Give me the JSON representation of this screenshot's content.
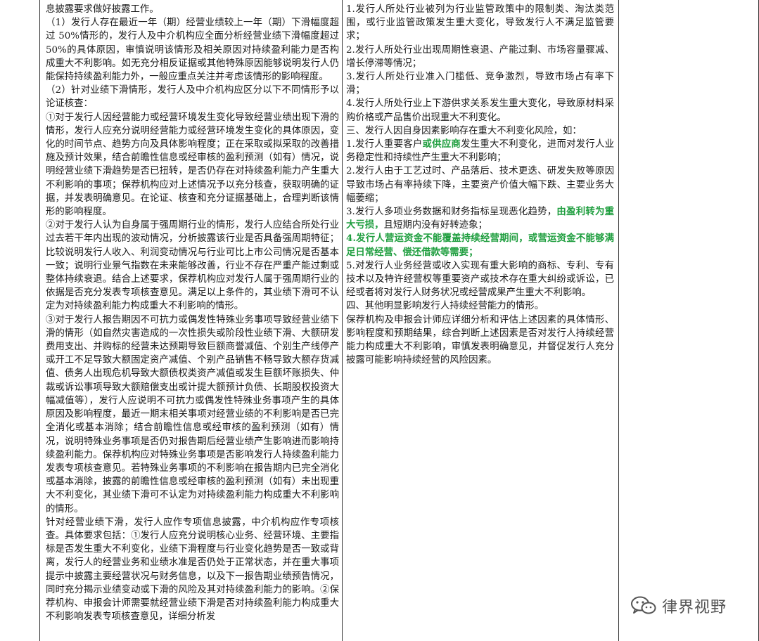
{
  "left_paragraphs": [
    "息披露要求做好披露工作。",
    "（1）发行人存在最近一年（期）经营业绩较上一年（期）下滑幅度超过 50%情形的，发行人及中介机构应全面分析经营业绩下滑幅度超过 50%的具体原因，审慎说明该情形及相关原因对持续盈利能力是否构成重大不利影响。如无充分相反证据或其他特殊原因能够说明发行人仍能保持持续盈利能力外，一般应重点关注并考虑该情形的影响程度。",
    "（2）针对业绩下滑情形，发行人及中介机构应区分以下不同情形予以论证核查：",
    "①对于发行人因经营能力或经营环境发生变化导致经营业绩出现下滑的情形，发行人应充分说明经营能力或经营环境发生变化的具体原因，变化的时间节点、趋势方向及具体影响程度；正在采取或拟采取的改善措施及预计效果，结合前瞻性信息或经审核的盈利预测（如有）情况，说明经营业绩下滑趋势是否已扭转，是否仍存在对持续盈利能力产生重大不利影响的事项；保荐机构应对上述情况予以充分核查，获取明确的证据，并发表明确意见。在论证、核查和充分证据基础上，合理判断该情形的影响程度。",
    "②对于发行人认为自身属于强周期行业的情形，发行人应结合所处行业过去若干年内出现的波动情况，分析披露该行业是否具备强周期特征；比较说明发行人收入、利润变动情况与行业可比上市公司情况是否基本一致；说明行业景气指数在未来能够改善，行业不存在严重产能过剩或整体持续衰退。结合上述要求，保荐机构应对发行人属于强周期行业的依据是否充分发表专项核查意见。满足以上条件的，其业绩下滑可不认定为对持续盈利能力构成重大不利影响的情形。",
    "③对于发行人报告期因不可抗力或偶发性特殊业务事项导致经营业绩下滑的情形（如自然灾害造成的一次性损失或阶段性业绩下滑、大额研发费用支出、并购标的经营未达预期导致巨额商誉减值、个别生产线停产或开工不足导致大额固定资产减值、个别产品销售不畅导致大额存货减值、债务人出现危机导致大额债权类资产减值或发生巨额坏账损失、仲裁或诉讼事项导致大额赔偿支出或计提大额预计负债、长期股权投资大幅减值等），发行人应说明不可抗力或偶发性特殊业务事项产生的具体原因及影响程度，最近一期末相关事项对经营业绩的不利影响是否已完全消化或基本消除；结合前瞻性信息或经审核的盈利预测（如有）情况，说明特殊业务事项是否仍对报告期后经营业绩产生影响进而影响持续盈利能力。保荐机构应对特殊业务事项是否影响发行人持续盈利能力发表专项核查意见。若特殊业务事项的不利影响在报告期内已完全消化或基本消除，披露的前瞻性信息或经审核的盈利预测（如有）未出现重大不利变化，其业绩下滑可不认定为对持续盈利能力构成重大不利影响的情形。",
    "针对经营业绩下滑，发行人应作专项信息披露，中介机构应作专项核查。具体要求包括：①发行人应充分说明核心业务、经营环境、主要指标是否发生重大不利变化，业绩下滑程度与行业变化趋势是否一致或背离，发行人的经营业务和业绩水准是否仍处于正常状态，并在重大事项提示中披露主要经营状况与财务信息，以及下一报告期业绩预告情况，同时充分揭示业绩变动或下滑的风险及其对持续盈利能力的影响。②保荐机构、申报会计师需要就经营业绩下滑是否对持续盈利能力构成重大不利影响发表专项核查意见，详细分析发"
  ],
  "right_paragraphs": [
    {
      "parts": [
        {
          "t": "1.发行人所处行业被列为行业监管政策中的限制类、淘汰类范围，或行业监管政策发生重大变化，导致发行人不满足监管要求；"
        }
      ]
    },
    {
      "parts": [
        {
          "t": "2.发行人所处行业出现周期性衰退、产能过剩、市场容量骤减、增长停滞等情况；"
        }
      ]
    },
    {
      "parts": [
        {
          "t": "3.发行人所处行业准入门槛低、竞争激烈，导致市场占有率下滑；"
        }
      ]
    },
    {
      "parts": [
        {
          "t": "4.发行人所处行业上下游供求关系发生重大变化，导致原材料采购价格或产品售价出现重大不利变化。"
        }
      ]
    },
    {
      "parts": [
        {
          "t": "三、发行人因自身因素影响存在重大不利变化风险，如："
        }
      ]
    },
    {
      "parts": [
        {
          "t": "1.发行人重要客户"
        },
        {
          "t": "或供应商",
          "hl": true
        },
        {
          "t": "发生重大不利变化，进而对发行人业务稳定性和持续性产生重大不利影响；"
        }
      ]
    },
    {
      "parts": [
        {
          "t": "2.发行人由于工艺过时、产品落后、技术更迭、研发失败等原因导致市场占有率持续下降，主要资产价值大幅下跌、主要业务大幅萎缩；"
        }
      ]
    },
    {
      "parts": [
        {
          "t": "3.发行人多项业务数据和财务指标呈现恶化趋势，"
        },
        {
          "t": "由盈利转为重大亏损，",
          "hl": true
        },
        {
          "t": "且短期内没有好转迹象；"
        }
      ]
    },
    {
      "parts": [
        {
          "t": "4.发行人营运资金不能覆盖持续经营期间，或营运资金不能够满足日常经营、偿还借款等需要；",
          "hl": true
        }
      ]
    },
    {
      "parts": [
        {
          "t": "5.对发行人业务经营或收入实现有重大影响的商标、专利、专有技术以及特许经营权等重要资产或技术存在重大纠纷或诉讼，已经或者将对发行人财务状况或经营成果产生重大不利影响。"
        }
      ]
    },
    {
      "parts": [
        {
          "t": "四、其他明显影响发行人持续经营能力的情形。"
        }
      ]
    },
    {
      "parts": [
        {
          "t": "保荐机构及申报会计师应详细分析和评估上述因素的具体情形、影响程度和预期结果，综合判断上述因素是否对发行人持续经营能力构成重大不利影响，审慎发表明确意见，并督促发行人充分披露可能影响持续经营的风险因素。"
        }
      ]
    }
  ],
  "watermark": {
    "text": "律界视野",
    "icon": "wechat-icon",
    "color": "#555555"
  },
  "colors": {
    "highlight": "#1f9e3f",
    "border": "#333333",
    "text": "#1a1a1a"
  }
}
